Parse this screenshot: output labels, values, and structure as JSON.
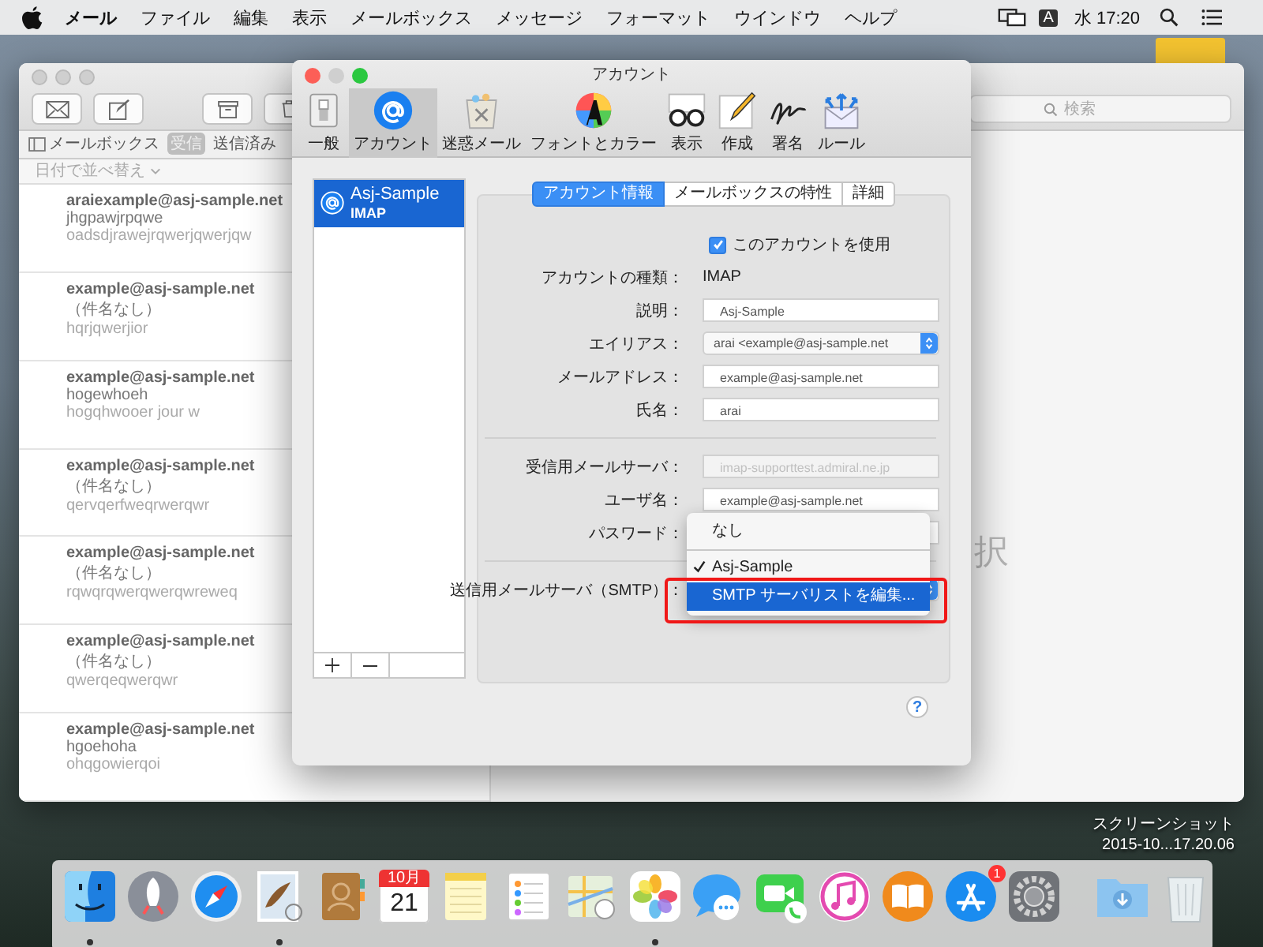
{
  "menu_bar": {
    "app_name": "メール",
    "menus": [
      "ファイル",
      "編集",
      "表示",
      "メールボックス",
      "メッセージ",
      "フォーマット",
      "ウインドウ",
      "ヘルプ"
    ],
    "input_mode": "A",
    "clock": "水 17:20"
  },
  "mail_window": {
    "search_placeholder": "検索",
    "mailboxes_label": "メールボックス",
    "favorites": [
      {
        "label": "受信",
        "selected": true
      },
      {
        "label": "送信済み",
        "selected": false
      }
    ],
    "sort_label": "日付で並べ替え",
    "messages": [
      {
        "sender": "araiexample@asj-sample.net",
        "subject": "jhgpawjrpqwe",
        "preview": "oadsdjrawejrqwerjqwerjqw"
      },
      {
        "sender": "example@asj-sample.net",
        "subject": "（件名なし）",
        "preview": "hqrjqwerjior"
      },
      {
        "sender": "example@asj-sample.net",
        "subject": "hogewhoeh",
        "preview": "hogqhwooer jour w"
      },
      {
        "sender": "example@asj-sample.net",
        "subject": "（件名なし）",
        "preview": "qervqerfweqrwerqwr"
      },
      {
        "sender": "example@asj-sample.net",
        "subject": "（件名なし）",
        "preview": "rqwqrqwerqwerqwreweq"
      },
      {
        "sender": "example@asj-sample.net",
        "subject": "（件名なし）",
        "preview": "qwerqeqwerqwr"
      },
      {
        "sender": "example@asj-sample.net",
        "subject": "hgoehoha",
        "preview": "ohqgowierqoi"
      }
    ],
    "empty_notice": "択"
  },
  "preferences_window": {
    "title": "アカウント",
    "toolbar": [
      {
        "label": "一般",
        "kind": "switch",
        "selected": false
      },
      {
        "label": "アカウント",
        "kind": "at",
        "selected": true
      },
      {
        "label": "迷惑メール",
        "kind": "junk",
        "selected": false
      },
      {
        "label": "フォントとカラー",
        "kind": "fonts",
        "selected": false
      },
      {
        "label": "表示",
        "kind": "glasses",
        "selected": false
      },
      {
        "label": "作成",
        "kind": "compose",
        "selected": false
      },
      {
        "label": "署名",
        "kind": "signature",
        "selected": false
      },
      {
        "label": "ルール",
        "kind": "rules",
        "selected": false
      }
    ],
    "accounts": [
      {
        "name": "Asj-Sample",
        "type": "IMAP",
        "selected": true
      }
    ],
    "tabs": [
      {
        "label": "アカウント情報",
        "selected": true
      },
      {
        "label": "メールボックスの特性",
        "selected": false
      },
      {
        "label": "詳細",
        "selected": false
      }
    ],
    "use_account": {
      "label": "このアカウントを使用",
      "checked": true
    },
    "groups": [
      [
        {
          "label": "アカウントの種類：",
          "kind": "text",
          "value": "IMAP",
          "disabled": false
        },
        {
          "label": "説明：",
          "kind": "field",
          "value": "Asj-Sample",
          "disabled": false
        },
        {
          "label": "エイリアス：",
          "kind": "popup",
          "value": "arai <example@asj-sample.net",
          "disabled": false
        },
        {
          "label": "メールアドレス：",
          "kind": "field",
          "value": "example@asj-sample.net",
          "disabled": false
        },
        {
          "label": "氏名：",
          "kind": "field",
          "value": "arai",
          "disabled": false
        }
      ],
      [
        {
          "label": "受信用メールサーバ：",
          "kind": "field",
          "value": "imap-supporttest.admiral.ne.jp",
          "disabled": true
        },
        {
          "label": "ユーザ名：",
          "kind": "field",
          "value": "example@asj-sample.net",
          "disabled": false
        },
        {
          "label": "パスワード：",
          "kind": "field",
          "disabled": false
        }
      ],
      [
        {
          "label": "送信用メールサーバ（SMTP）：",
          "kind": "popup",
          "disabled": false
        }
      ]
    ],
    "menu": [
      {
        "label": "なし",
        "checked": false,
        "highlighted": false,
        "annotated": false,
        "separator_after": true
      },
      {
        "label": "Asj-Sample",
        "checked": true,
        "highlighted": false,
        "annotated": false,
        "separator_after": false
      },
      {
        "label": "SMTP サーバリストを編集...",
        "checked": false,
        "highlighted": true,
        "annotated": true,
        "separator_after": false
      }
    ],
    "help_label": "?"
  },
  "desktop_file": {
    "name_lines": [
      "スクリーンショット",
      "2015-10...17.20.06"
    ]
  },
  "dock": [
    {
      "kind": "face",
      "running": true
    },
    {
      "kind": "rocket",
      "running": false
    },
    {
      "kind": "compass",
      "running": false
    },
    {
      "kind": "stamp",
      "running": true
    },
    {
      "kind": "contacts",
      "running": false
    },
    {
      "kind": "calendar",
      "running": false,
      "month": "10月",
      "day": "21"
    },
    {
      "kind": "notepad",
      "running": false
    },
    {
      "kind": "checklist",
      "running": false
    },
    {
      "kind": "map",
      "running": false
    },
    {
      "kind": "flower",
      "running": true
    },
    {
      "kind": "speech",
      "running": false
    },
    {
      "kind": "video",
      "running": false
    },
    {
      "kind": "music",
      "running": false
    },
    {
      "kind": "book",
      "running": false
    },
    {
      "kind": "appstore",
      "running": false,
      "badge": "1"
    },
    {
      "kind": "gear",
      "running": false
    },
    {
      "kind": "separator"
    },
    {
      "kind": "downloads",
      "running": false
    },
    {
      "kind": "trash",
      "running": false
    }
  ]
}
